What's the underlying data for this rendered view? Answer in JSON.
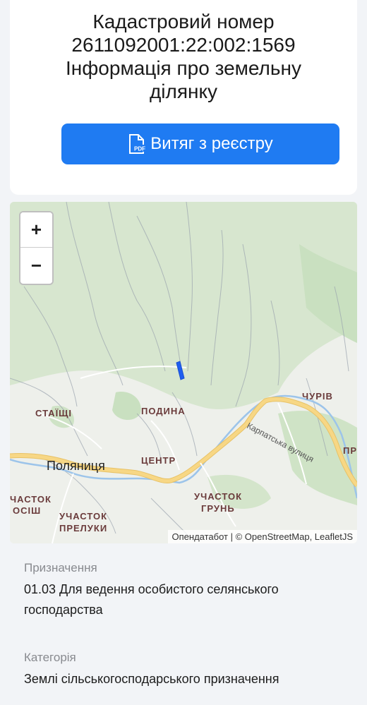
{
  "header": {
    "title_line1": "Кадастровий номер",
    "cadastral_number": "2611092001:22:002:1569",
    "title_line3": "Інформація про земельну",
    "title_line4": "ділянку",
    "pdf_button_label": "Витяг з реєстру",
    "pdf_icon_text": "PDF"
  },
  "map": {
    "zoom_in": "+",
    "zoom_out": "−",
    "attribution": "Опендатабот | © OpenStreetMap, LeafletJS",
    "places": {
      "staishchi": "СТАЇЩІ",
      "podyna": "ПОДИНА",
      "churiv": "ЧУРІВ",
      "tsentr": "ЦЕНТР",
      "polianytsia": "Поляниця",
      "uchastok_hrun_1": "УЧАСТОК",
      "uchastok_hrun_2": "ГРУНЬ",
      "uchastok_preluky_1": "УЧАСТОК",
      "uchastok_preluky_2": "ПРЕЛУКИ",
      "uchastok_left_1": "ЧАСТОК",
      "uchastok_left_2": "ОСІШ",
      "pr_edge": "ПР"
    },
    "street": "Карпатська вулиця"
  },
  "details": [
    {
      "label": "Призначення",
      "value_line1": "01.03 Для ведення особистого селянського",
      "value_line2": "господарства"
    },
    {
      "label": "Категорія",
      "value_line1": "Землі сільськогосподарського призначення"
    }
  ],
  "colors": {
    "accent": "#1f7bf2",
    "parcel": "#1f5ff0",
    "road": "#f7d785"
  }
}
